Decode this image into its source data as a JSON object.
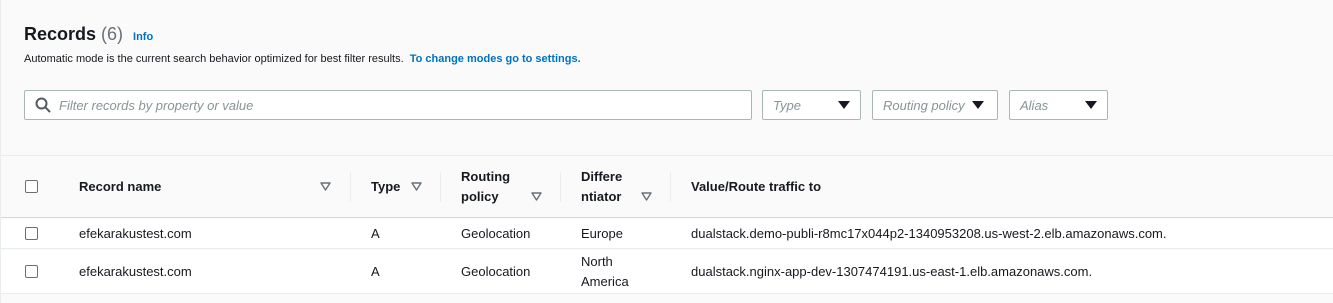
{
  "header": {
    "title": "Records",
    "count": "(6)",
    "info": "Info",
    "description": "Automatic mode is the current search behavior optimized for best filter results.",
    "settings_link": "To change modes go to settings."
  },
  "filters": {
    "search_placeholder": "Filter records by property or value",
    "type_placeholder": "Type",
    "routing_placeholder": "Routing policy",
    "alias_placeholder": "Alias"
  },
  "table": {
    "columns": {
      "record_name": "Record name",
      "type": "Type",
      "routing_line1": "Routing",
      "routing_line2": "policy",
      "diff_line1": "Differe",
      "diff_line2": "ntiator",
      "value": "Value/Route traffic to"
    },
    "rows": [
      {
        "name": "efekarakustest.com",
        "type": "A",
        "routing": "Geolocation",
        "diff_line1": "Europe",
        "diff_line2": "",
        "value": "dualstack.demo-publi-r8mc17x044p2-1340953208.us-west-2.elb.amazonaws.com."
      },
      {
        "name": "efekarakustest.com",
        "type": "A",
        "routing": "Geolocation",
        "diff_line1": "North",
        "diff_line2": "America",
        "value": "dualstack.nginx-app-dev-1307474191.us-east-1.elb.amazonaws.com."
      }
    ]
  }
}
